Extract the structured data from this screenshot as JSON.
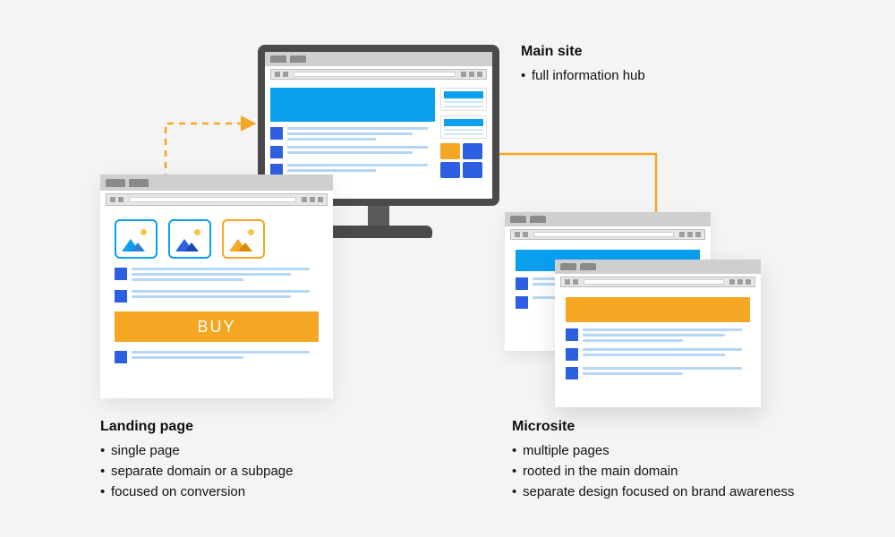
{
  "main_site": {
    "title": "Main site",
    "bullets": [
      "full information hub"
    ]
  },
  "landing_page": {
    "title": "Landing page",
    "bullets": [
      "single page",
      "separate domain or a subpage",
      "focused on conversion"
    ],
    "cta_label": "BUY"
  },
  "microsite": {
    "title": "Microsite",
    "bullets": [
      "multiple pages",
      "rooted in the main domain",
      "separate design focused on brand awareness"
    ]
  },
  "colors": {
    "primary_blue": "#0b9ff0",
    "accent_blue": "#2d5fe3",
    "accent_orange": "#f5a623",
    "monitor": "#4a4a4a"
  }
}
